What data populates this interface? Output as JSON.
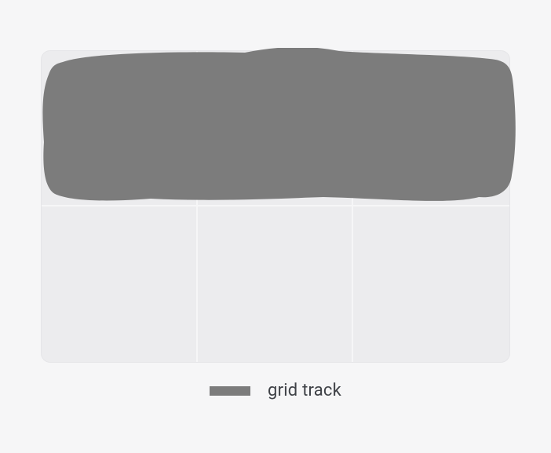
{
  "diagram": {
    "grid": {
      "columns": 3,
      "rows": 2,
      "highlighted_track": "row 1"
    }
  },
  "legend": {
    "label": "grid track"
  },
  "colors": {
    "highlight": "#7c7c7c",
    "cell_bg": "#ececee",
    "page_bg": "#f6f6f7",
    "divider": "#f6f6f7",
    "border": "#e5e5e8",
    "text": "#3f4247"
  }
}
